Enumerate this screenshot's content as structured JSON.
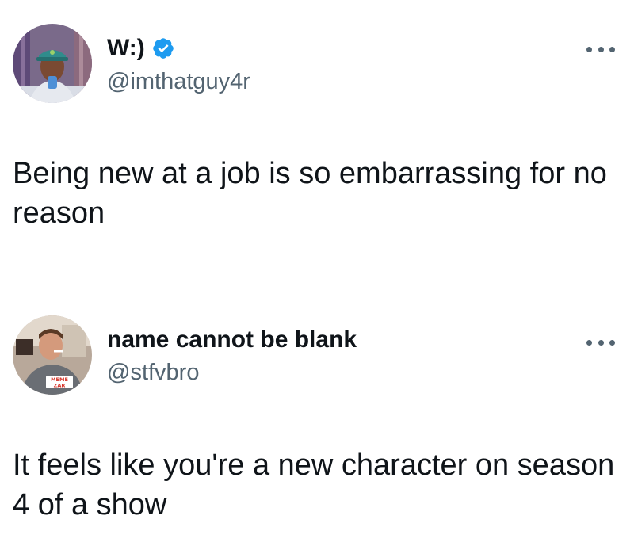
{
  "tweets": [
    {
      "display_name": "W:)",
      "handle": "@imthatguy4r",
      "verified": true,
      "text": "Being new at a job is so embarrassing for no reason",
      "avatar_icon": "profile-photo-man-in-cap-icon"
    },
    {
      "display_name": "name cannot be blank",
      "handle": "@stfvbro",
      "verified": false,
      "text": "It feels like you're a new character on season 4 of a show",
      "avatar_icon": "profile-photo-man-smoking-icon",
      "avatar_watermark": "MEME ZAR"
    }
  ],
  "colors": {
    "text": "#0f1419",
    "secondary": "#536471",
    "verified": "#1d9bf0"
  }
}
